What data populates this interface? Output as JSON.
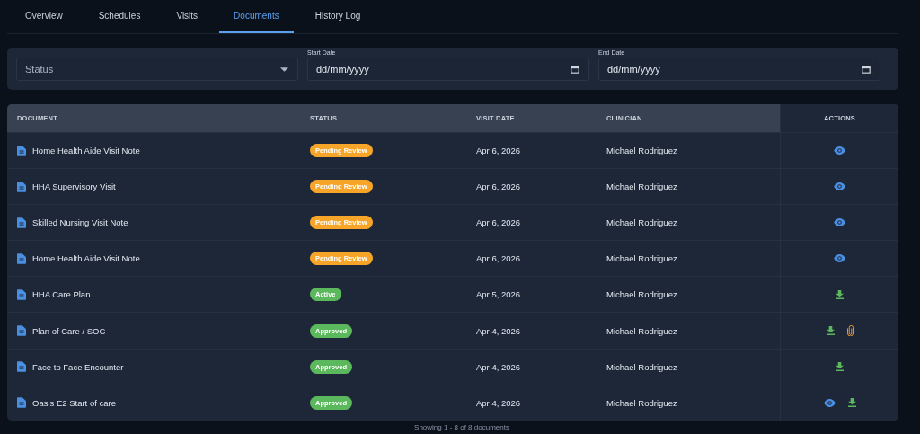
{
  "tabs": [
    {
      "label": "Overview",
      "selected": false
    },
    {
      "label": "Schedules",
      "selected": false
    },
    {
      "label": "Visits",
      "selected": false
    },
    {
      "label": "Documents",
      "selected": true
    },
    {
      "label": "History Log",
      "selected": false
    }
  ],
  "filters": {
    "status": {
      "placeholder": "Status"
    },
    "start_date": {
      "label": "Start Date",
      "value": "dd/mm/yyyy"
    },
    "end_date": {
      "label": "End Date",
      "value": "dd/mm/yyyy"
    }
  },
  "table": {
    "columns": [
      "DOCUMENT",
      "STATUS",
      "VISIT DATE",
      "CLINICIAN",
      "ACTIONS"
    ],
    "rows": [
      {
        "document": "Home Health Aide Visit Note",
        "status": {
          "label": "Pending Review",
          "color": "#f6a528"
        },
        "visit_date": "Apr 6, 2026",
        "clinician": "Michael Rodriguez",
        "actions": [
          {
            "kind": "view"
          }
        ]
      },
      {
        "document": "HHA Supervisory Visit",
        "status": {
          "label": "Pending Review",
          "color": "#f6a528"
        },
        "visit_date": "Apr 6, 2026",
        "clinician": "Michael Rodriguez",
        "actions": [
          {
            "kind": "view"
          }
        ]
      },
      {
        "document": "Skilled Nursing Visit Note",
        "status": {
          "label": "Pending Review",
          "color": "#f6a528"
        },
        "visit_date": "Apr 6, 2026",
        "clinician": "Michael Rodriguez",
        "actions": [
          {
            "kind": "view"
          }
        ]
      },
      {
        "document": "Home Health Aide Visit Note",
        "status": {
          "label": "Pending Review",
          "color": "#f6a528"
        },
        "visit_date": "Apr 6, 2026",
        "clinician": "Michael Rodriguez",
        "actions": [
          {
            "kind": "view"
          }
        ]
      },
      {
        "document": "HHA Care Plan",
        "status": {
          "label": "Active",
          "color": "#5cb85c"
        },
        "visit_date": "Apr 5, 2026",
        "clinician": "Michael Rodriguez",
        "actions": [
          {
            "kind": "download"
          }
        ]
      },
      {
        "document": "Plan of Care / SOC",
        "status": {
          "label": "Approved",
          "color": "#5cb85c"
        },
        "visit_date": "Apr 4, 2026",
        "clinician": "Michael Rodriguez",
        "actions": [
          {
            "kind": "download"
          },
          {
            "kind": "attachment"
          }
        ]
      },
      {
        "document": "Face to Face Encounter",
        "status": {
          "label": "Approved",
          "color": "#5cb85c"
        },
        "visit_date": "Apr 4, 2026",
        "clinician": "Michael Rodriguez",
        "actions": [
          {
            "kind": "download"
          }
        ]
      },
      {
        "document": "Oasis E2 Start of care",
        "status": {
          "label": "Approved",
          "color": "#5cb85c"
        },
        "visit_date": "Apr 4, 2026",
        "clinician": "Michael Rodriguez",
        "actions": [
          {
            "kind": "view"
          },
          {
            "kind": "download"
          }
        ]
      }
    ]
  },
  "footer": "Showing 1 - 8 of 8 documents"
}
